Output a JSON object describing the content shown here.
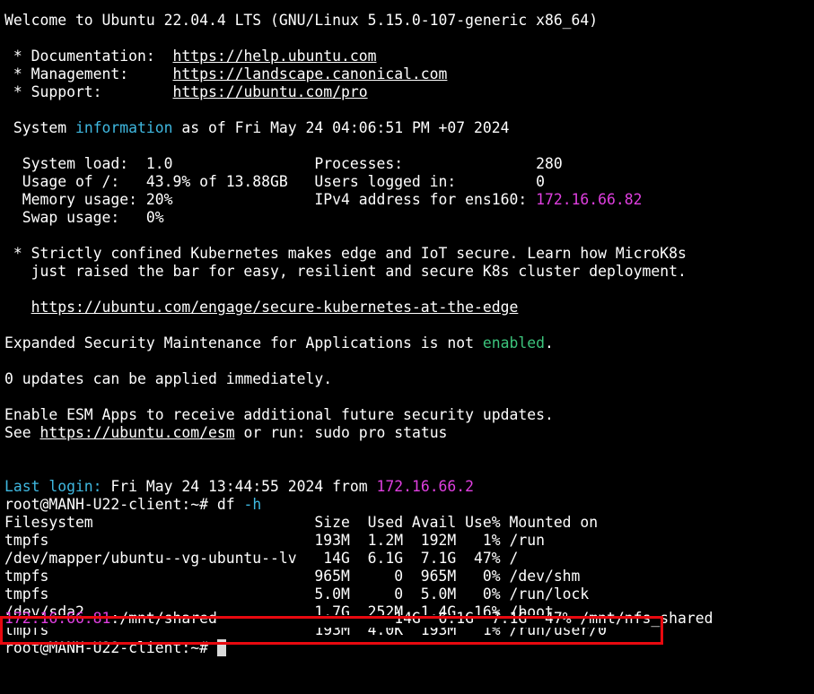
{
  "welcome": "Welcome to Ubuntu 22.04.4 LTS (GNU/Linux 5.15.0-107-generic x86_64)",
  "links": {
    "doc_label": " * Documentation:  ",
    "doc_url": "https://help.ubuntu.com",
    "mgmt_label": " * Management:     ",
    "mgmt_url": "https://landscape.canonical.com",
    "support_label": " * Support:        ",
    "support_url": "https://ubuntu.com/pro"
  },
  "sysinfo": {
    "prefix": " System ",
    "word": "information",
    "suffix": " as of Fri May 24 04:06:51 PM +07 2024",
    "row1": "  System load:  1.0                Processes:               280",
    "row2": "  Usage of /:   43.9% of 13.88GB   Users logged in:         0",
    "row3_left": "  Memory usage: 20%                IPv4 address for ens160: ",
    "row3_ip": "172.16.66.82",
    "row4": "  Swap usage:   0%"
  },
  "k8s": {
    "line1": " * Strictly confined Kubernetes makes edge and IoT secure. Learn how MicroK8s",
    "line2": "   just raised the bar for easy, resilient and secure K8s cluster deployment.",
    "url_indent": "   ",
    "url": "https://ubuntu.com/engage/secure-kubernetes-at-the-edge"
  },
  "esm": {
    "prefix": "Expanded Security Maintenance for Applications is not ",
    "enabled": "enabled",
    "suffix": ".",
    "updates": "0 updates can be applied immediately.",
    "enable_line": "Enable ESM Apps to receive additional future security updates.",
    "see_prefix": "See ",
    "see_url": "https://ubuntu.com/esm",
    "see_suffix": " or run: sudo pro status"
  },
  "login": {
    "label": "Last login:",
    "date": " Fri May 24 13:44:55 2024 from ",
    "ip": "172.16.66.2"
  },
  "prompt": {
    "text": "root@MANH-U22-client:~# ",
    "command": "df",
    "flag": "-h"
  },
  "df": {
    "header": "Filesystem                         Size  Used Avail Use% Mounted on",
    "rows": [
      "tmpfs                              193M  1.2M  192M   1% /run",
      "/dev/mapper/ubuntu--vg-ubuntu--lv   14G  6.1G  7.1G  47% /",
      "tmpfs                              965M     0  965M   0% /dev/shm",
      "tmpfs                              5.0M     0  5.0M   0% /run/lock",
      "/dev/sda2                          1.7G  252M  1.4G  16% /boot"
    ],
    "nfs_ip": "172.16.66.81",
    "nfs_rest": ":/mnt/shared                    14G  6.1G  7.1G  47% /mnt/nfs_shared",
    "last_row": "tmpfs                              193M  4.0K  193M   1% /run/user/0"
  },
  "final_prompt": "root@MANH-U22-client:~# ",
  "colors": {
    "background": "#000000",
    "foreground": "#ffffff",
    "cyan": "#3fb8e0",
    "green": "#3cc47c",
    "magenta": "#e03fe0",
    "highlight_border": "#e8090f"
  }
}
